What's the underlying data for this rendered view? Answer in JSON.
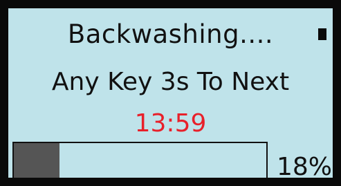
{
  "screen": {
    "title": "Backwashing....",
    "instruction": "Any Key 3s To Next",
    "countdown": "13:59",
    "progress_label": "18%",
    "progress_fraction": 0.18,
    "indicator_icon": "status-square-icon"
  },
  "colors": {
    "background": "#bfe3ea",
    "frame": "#0a0a0a",
    "text": "#111111",
    "countdown": "#e8202a",
    "progress_fill": "#555555"
  }
}
